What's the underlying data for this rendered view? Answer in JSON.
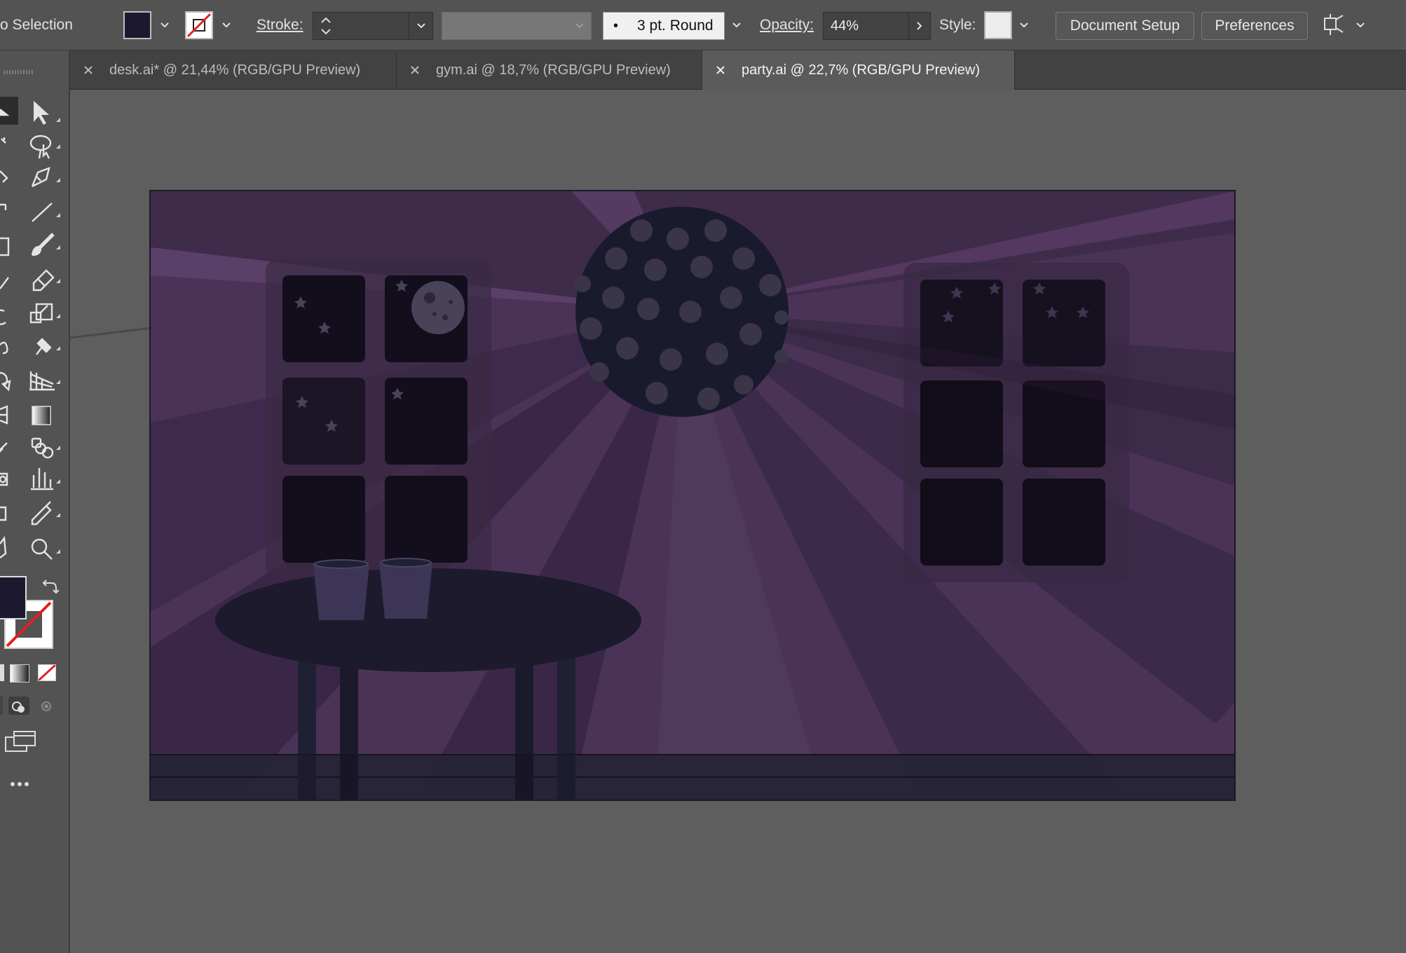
{
  "control_bar": {
    "selection_label": "o Selection",
    "stroke_label": "Stroke:",
    "brush_label": "3 pt. Round",
    "opacity_label": "Opacity:",
    "opacity_value": "44%",
    "style_label": "Style:",
    "document_setup_button": "Document Setup",
    "preferences_button": "Preferences",
    "fill_color": "#1c1830"
  },
  "tabs": [
    {
      "label": "desk.ai* @ 21,44% (RGB/GPU Preview)",
      "active": false
    },
    {
      "label": "gym.ai @ 18,7% (RGB/GPU Preview)",
      "active": false
    },
    {
      "label": "party.ai @ 22,7% (RGB/GPU Preview)",
      "active": true
    }
  ],
  "tools": [
    "selection-tool-icon",
    "direct-selection-tool-icon",
    "magic-wand-tool-icon",
    "lasso-tool-icon",
    "pen-tool-icon",
    "curvature-tool-icon",
    "type-tool-icon",
    "line-tool-icon",
    "rectangle-tool-icon",
    "paintbrush-tool-icon",
    "shaper-tool-icon",
    "eraser-tool-icon",
    "rotate-tool-icon",
    "scale-tool-icon",
    "warp-tool-icon",
    "puppet-warp-tool-icon",
    "shape-builder-tool-icon",
    "perspective-grid-tool-icon",
    "mesh-tool-icon",
    "gradient-tool-icon",
    "eyedropper-tool-icon",
    "blend-tool-icon",
    "symbol-sprayer-tool-icon",
    "column-graph-tool-icon",
    "artboard-tool-icon",
    "slice-tool-icon",
    "hand-tool-icon",
    "zoom-tool-icon"
  ],
  "artwork": {
    "background_color": "#4b3357",
    "floor_color": "#262436",
    "disco_ball_color": "#1a1a2e",
    "window_color": "#120e1c",
    "table_color": "#1d1a2e"
  }
}
